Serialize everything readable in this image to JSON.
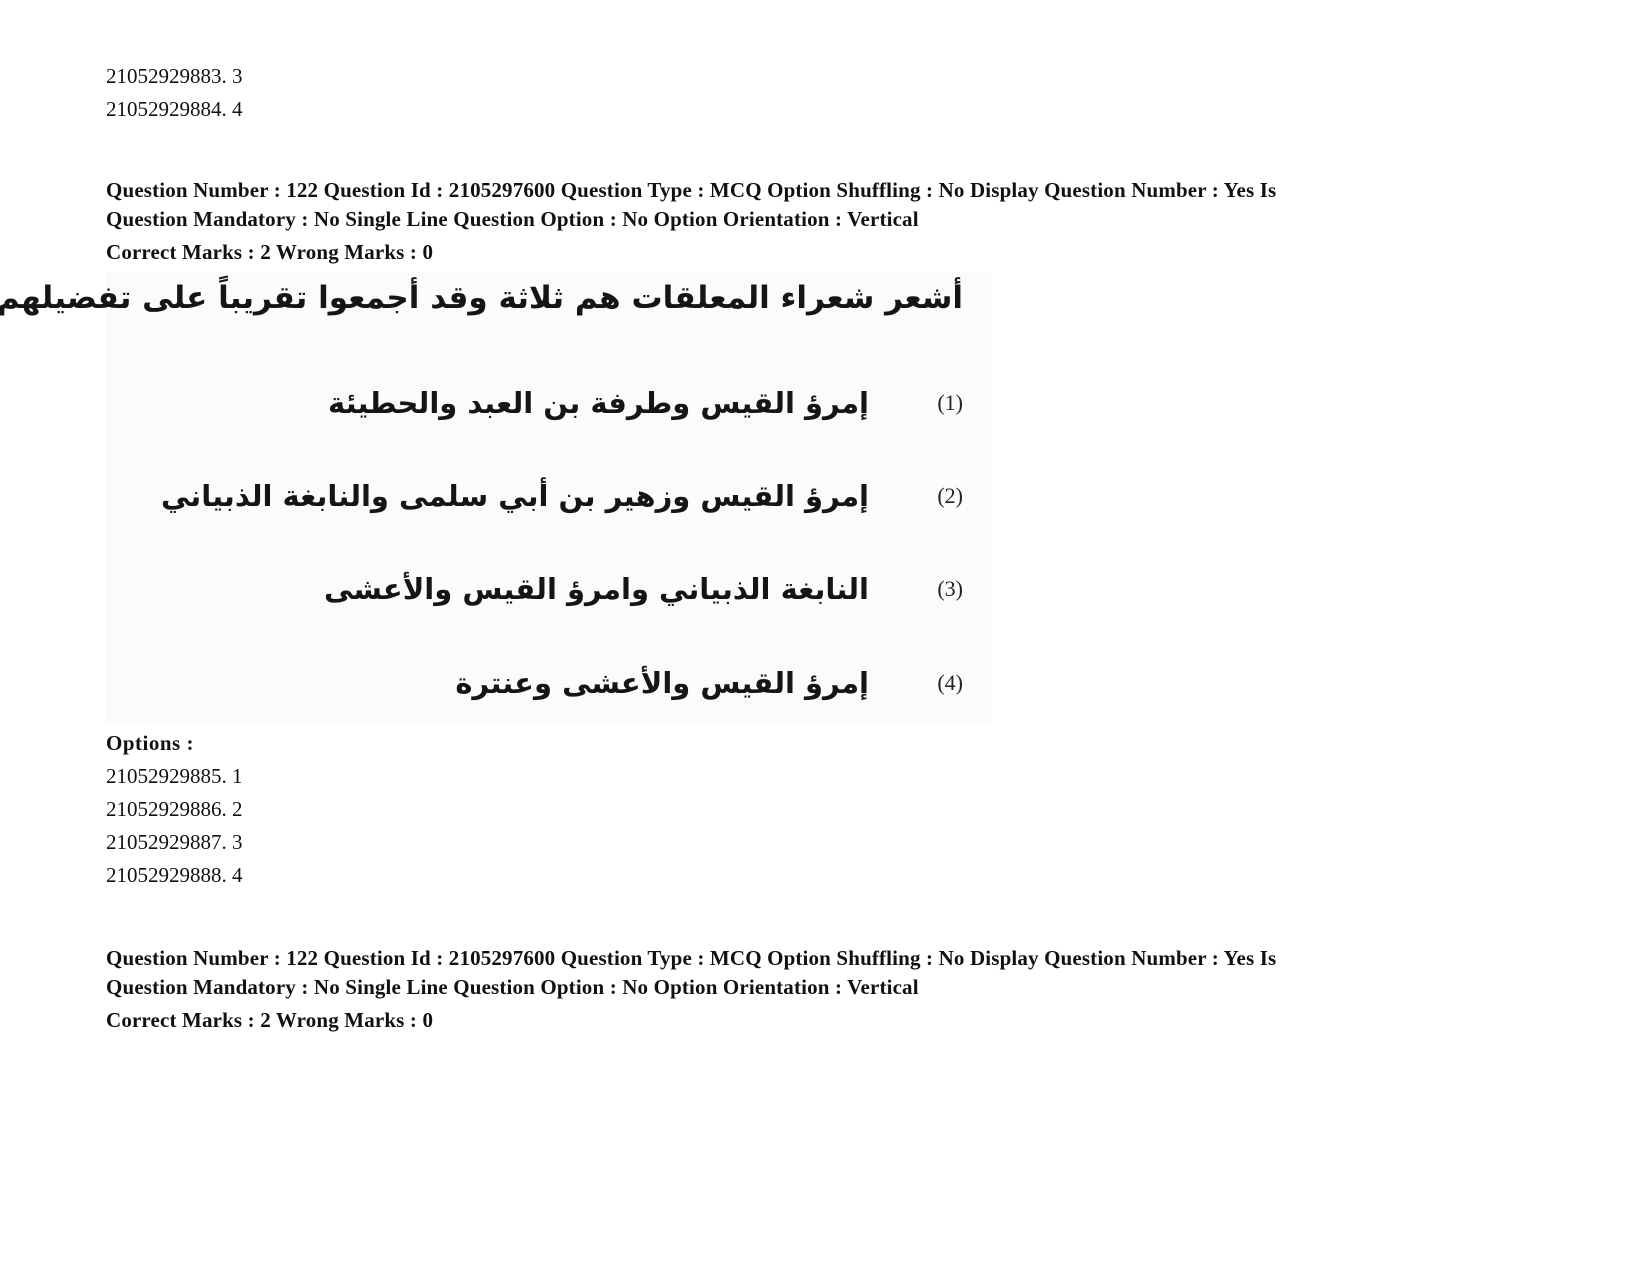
{
  "previous_options": [
    {
      "id": "21052929883",
      "label": "3"
    },
    {
      "id": "21052929884",
      "label": "4"
    }
  ],
  "question_blocks": [
    {
      "meta_line_1": "Question Number : 122 Question Id : 2105297600 Question Type : MCQ Option Shuffling : No Display Question Number : Yes Is",
      "meta_line_2": "Question Mandatory : No Single Line Question Option : No Option Orientation : Vertical",
      "marks_line": "Correct Marks : 2 Wrong Marks : 0"
    },
    {
      "meta_line_1": "Question Number : 122 Question Id : 2105297600 Question Type : MCQ Option Shuffling : No Display Question Number : Yes Is",
      "meta_line_2": "Question Mandatory : No Single Line Question Option : No Option Orientation : Vertical",
      "marks_line": "Correct Marks : 2 Wrong Marks : 0"
    }
  ],
  "question_image": {
    "stem": "أشعر شعراء المعلقات هم ثلاثة وقد أجمعوا تقريباً على تفضيلهم :",
    "choices": [
      {
        "num": "(1)",
        "text": "إمرؤ القيس وطرفة بن العبد والحطيئة"
      },
      {
        "num": "(2)",
        "text": "إمرؤ القيس وزهير بن أبي سلمى والنابغة الذبياني"
      },
      {
        "num": "(3)",
        "text": "النابغة الذبياني وامرؤ القيس والأعشى"
      },
      {
        "num": "(4)",
        "text": "إمرؤ القيس والأعشى وعنترة"
      }
    ]
  },
  "options": {
    "label": "Options :",
    "items": [
      {
        "text": "21052929885. 1"
      },
      {
        "text": "21052929886. 2"
      },
      {
        "text": "21052929887. 3"
      },
      {
        "text": "21052929888. 4"
      }
    ]
  },
  "previous_options_text": [
    "21052929883. 3",
    "21052929884. 4"
  ]
}
